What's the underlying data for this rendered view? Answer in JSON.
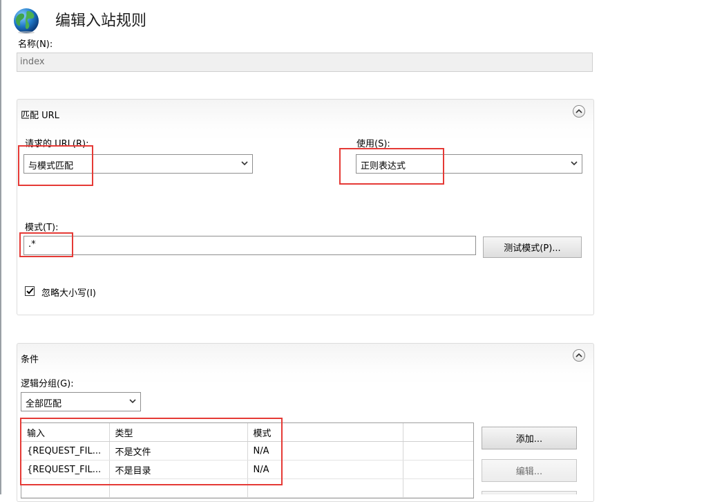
{
  "header": {
    "title": "编辑入站规则",
    "icon": "globe-icon"
  },
  "name_field": {
    "label": "名称(N):",
    "value": "index"
  },
  "match_url": {
    "title": "匹配 URL",
    "requested_url_label": "请求的 URL(R):",
    "requested_url_value": "与模式匹配",
    "using_label": "使用(S):",
    "using_value": "正则表达式",
    "pattern_label": "模式(T):",
    "pattern_value": ".*",
    "test_button": "测试模式(P)...",
    "ignore_case_label": "忽略大小写(I)",
    "ignore_case_checked": true
  },
  "conditions": {
    "title": "条件",
    "logical_grouping_label": "逻辑分组(G):",
    "logical_grouping_value": "全部匹配",
    "columns": [
      "输入",
      "类型",
      "模式",
      ""
    ],
    "rows": [
      [
        "{REQUEST_FIL...",
        "不是文件",
        "N/A",
        ""
      ],
      [
        "{REQUEST_FIL...",
        "不是目录",
        "N/A",
        ""
      ]
    ],
    "add_button": "添加...",
    "edit_button": "编辑..."
  },
  "colors": {
    "highlight": "#e53935",
    "panel_bg": "#f4f4f4"
  }
}
